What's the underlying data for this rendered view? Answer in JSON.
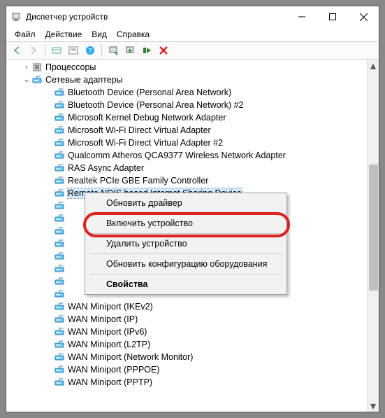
{
  "window": {
    "title": "Диспетчер устройств"
  },
  "menu": {
    "file": "Файл",
    "action": "Действие",
    "view": "Вид",
    "help": "Справка"
  },
  "tree": {
    "processors": {
      "label": "Процессоры",
      "expanded": false
    },
    "netadapters": {
      "label": "Сетевые адаптеры",
      "expanded": true,
      "items": [
        "Bluetooth Device (Personal Area Network)",
        "Bluetooth Device (Personal Area Network) #2",
        "Microsoft Kernel Debug Network Adapter",
        "Microsoft Wi-Fi Direct Virtual Adapter",
        "Microsoft Wi-Fi Direct Virtual Adapter #2",
        "Qualcomm Atheros QCA9377 Wireless Network Adapter",
        "RAS Async Adapter",
        "Realtek PCIe GBE Family Controller",
        "Remote NDIS based Internet Sharing Device",
        "",
        "",
        "",
        "",
        "",
        "",
        "",
        "",
        "WAN Miniport (IKEv2)",
        "WAN Miniport (IP)",
        "WAN Miniport (IPv6)",
        "WAN Miniport (L2TP)",
        "WAN Miniport (Network Monitor)",
        "WAN Miniport (PPPOE)",
        "WAN Miniport (PPTP)"
      ],
      "selected_index": 8
    }
  },
  "context_menu": {
    "update_driver": "Обновить драйвер",
    "enable_device": "Включить устройство",
    "uninstall": "Удалить устройство",
    "scan": "Обновить конфигурацию оборудования",
    "properties": "Свойства"
  }
}
